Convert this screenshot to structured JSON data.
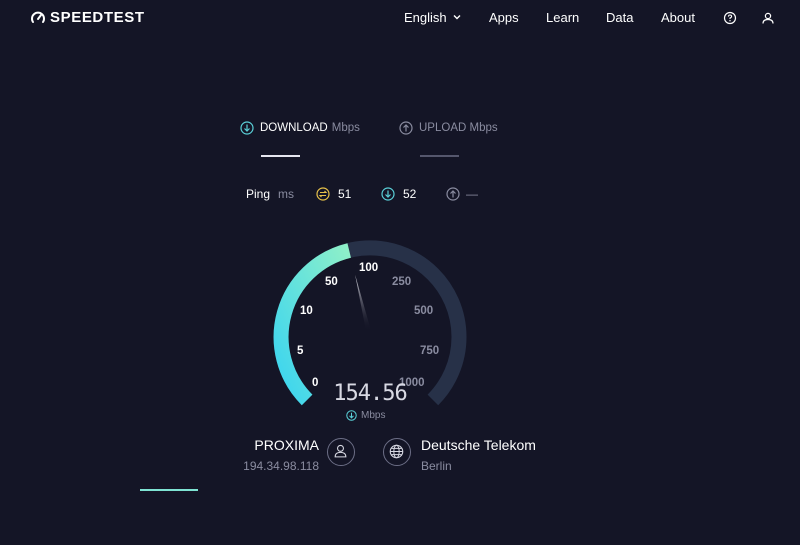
{
  "header": {
    "logo_text": "SPEEDTEST",
    "nav": {
      "language": "English",
      "apps": "Apps",
      "learn": "Learn",
      "data": "Data",
      "about": "About"
    }
  },
  "tabs": [
    {
      "label": "DOWNLOAD",
      "unit": "Mbps",
      "active": true
    },
    {
      "label": "UPLOAD Mbps",
      "unit": "",
      "active": false
    }
  ],
  "ping": {
    "label": "Ping",
    "unit": "ms",
    "idle": "51",
    "download": "52",
    "upload": "—"
  },
  "gauge": {
    "scale": [
      "0",
      "5",
      "10",
      "50",
      "100",
      "250",
      "500",
      "750",
      "1000"
    ],
    "value": "154.56",
    "unit": "Mbps",
    "fill_fraction": 0.45
  },
  "isp": {
    "name": "PROXIMA",
    "ip": "194.34.98.118"
  },
  "server": {
    "name": "Deutsche Telekom",
    "city": "Berlin"
  },
  "colors": {
    "background": "#141526",
    "accent": "#7fe3d3",
    "gauge_start": "#3ad4f0",
    "gauge_end": "#8ff0c8",
    "track": "#273148",
    "ping_idle": "#e8c24a",
    "download": "#5ad0d8",
    "upload": "#8a8ca0"
  }
}
